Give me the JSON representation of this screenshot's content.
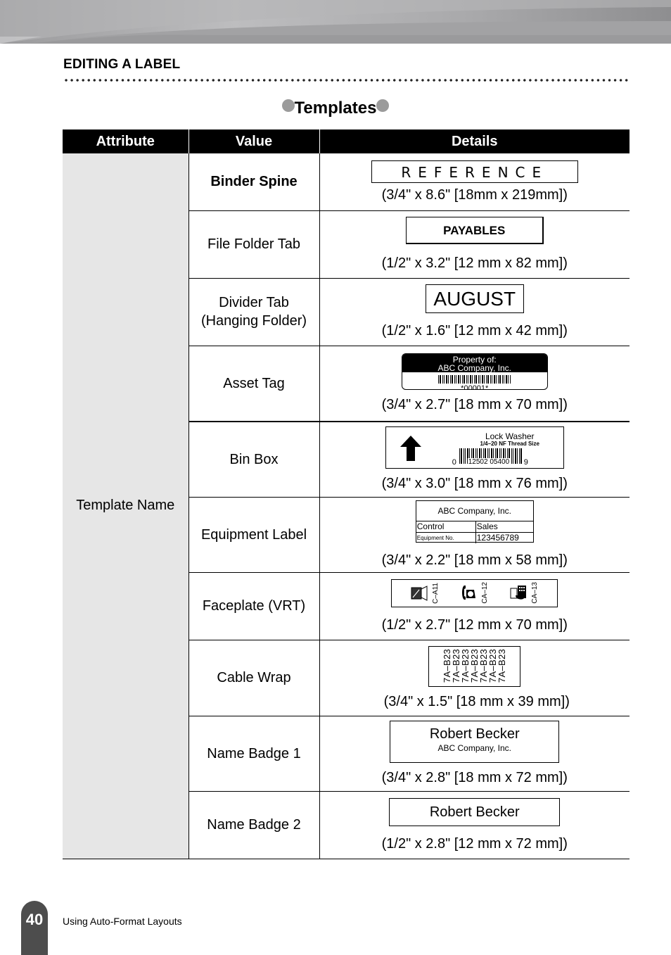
{
  "header": {
    "section_title": "EDITING A LABEL",
    "subsection_title": "Templates",
    "bullet_color": "#9b9b9b"
  },
  "table": {
    "columns": [
      "Attribute",
      "Value",
      "Details"
    ],
    "attribute": "Template Name",
    "rows": [
      {
        "value": "Binder Spine",
        "size": "(3/4\" x 8.6\" [18mm x 219mm])",
        "label_text": "REFERENCE"
      },
      {
        "value": "File Folder Tab",
        "size": "(1/2\" x 3.2\" [12 mm x 82 mm])",
        "label_text": "PAYABLES"
      },
      {
        "value": "Divider Tab (Hanging Folder)",
        "size": "(1/2\" x 1.6\" [12 mm x 42 mm])",
        "label_text": "AUGUST"
      },
      {
        "value": "Asset Tag",
        "size": "(3/4\" x 2.7\" [18 mm x 70 mm])",
        "label_line1": "Property of:",
        "label_line2": "ABC Company, Inc.",
        "label_code": "*00001*"
      },
      {
        "value": "Bin Box",
        "size": "(3/4\" x 3.0\" [18 mm x 76 mm])",
        "label_line1": "Lock Washer",
        "label_line2": "1/4–20 NF Thread Size",
        "barcode_left": "0",
        "barcode_mid": "12502  05400",
        "barcode_right": "9"
      },
      {
        "value": "Equipment Label",
        "size": "(3/4\" x 2.2\" [18 mm x 58 mm])",
        "label_header": "ABC Company, Inc.",
        "field1_name": "Control",
        "field1_value": "Sales",
        "field2_name": "Equipment No.",
        "field2_value": "123456789"
      },
      {
        "value": "Faceplate (VRT)",
        "size": "(1/2\" x 2.7\" [12 mm x 70 mm])",
        "port1": "C–A11",
        "port2": "CA–12",
        "port3": "CA–13"
      },
      {
        "value": "Cable Wrap",
        "size": "(3/4\" x 1.5\" [18 mm x 39 mm])",
        "label_text": "7A–B23",
        "repeat": 7
      },
      {
        "value": "Name Badge 1",
        "size": "(3/4\" x 2.8\" [18 mm x 72 mm])",
        "label_name": "Robert Becker",
        "label_company": "ABC Company, Inc."
      },
      {
        "value": "Name Badge 2",
        "size": "(1/2\" x 2.8\" [12 mm x 72 mm])",
        "label_name": "Robert Becker"
      }
    ]
  },
  "footer": {
    "page_number": "40",
    "section": "Using Auto-Format Layouts"
  }
}
